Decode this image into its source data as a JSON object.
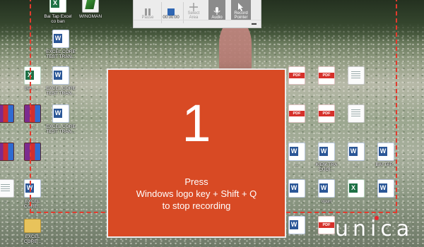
{
  "countdown": {
    "number": "1",
    "line1": "Press",
    "line2": "Windows logo key + Shift + Q",
    "line3": "to stop recording",
    "color": "#d84a24"
  },
  "toolbar": {
    "pause_label": "Pause",
    "timer": "00:00:00",
    "select_area_line1": "Select",
    "select_area_line2": "Area",
    "audio_label": "Audio",
    "record_pointer_line1": "Record",
    "record_pointer_line2": "Pointer"
  },
  "desktop": {
    "icons": {
      "i01": "Bai Tap Excel co ban",
      "i02": "WINGMAN",
      "i03": "EXCEL CORE TEST TRAN...",
      "i04": "Bai... ...",
      "i05": "EXCEL CORE TEST TRAN...",
      "i06": "EXCEL CORE TEST TRAN...",
      "i07": "...",
      "i08": "...",
      "i09": "...",
      "i10": "...",
      "i11": "...",
      "i12": "...",
      "i13": "EXCEL CORE...",
      "i14": "EXCEL CORE...",
      "i15": "...",
      "i16": "...",
      "i17": "...",
      "i18": "KIEM TRA CUOI...",
      "i19": "...",
      "i20": "court",
      "i21": "...",
      "i22": "BAI TAP...",
      "i23": "...",
      "i24": "..."
    }
  },
  "watermark": {
    "brand": "unica",
    "accent": "#e6262e"
  },
  "recording_border_color": "#e23b2e"
}
